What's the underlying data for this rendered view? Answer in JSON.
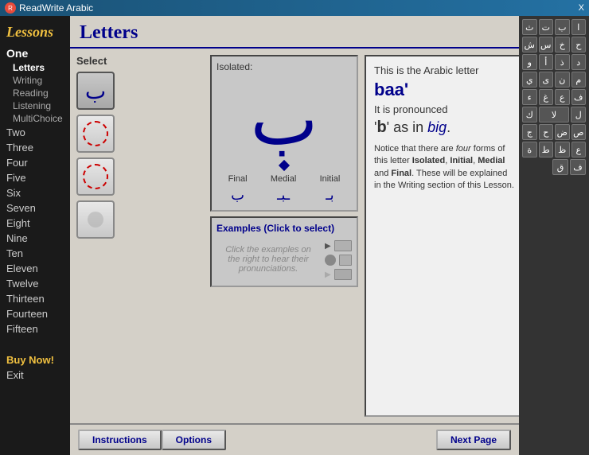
{
  "titlebar": {
    "title": "ReadWrite Arabic",
    "close_label": "X"
  },
  "sidebar": {
    "title": "Lessons",
    "items": [
      {
        "label": "One",
        "type": "main"
      },
      {
        "label": "Letters",
        "type": "sub",
        "active": true
      },
      {
        "label": "Writing",
        "type": "sub"
      },
      {
        "label": "Reading",
        "type": "sub"
      },
      {
        "label": "Listening",
        "type": "sub"
      },
      {
        "label": "MultiChoice",
        "type": "sub"
      },
      {
        "label": "Two",
        "type": "main"
      },
      {
        "label": "Three",
        "type": "main"
      },
      {
        "label": "Four",
        "type": "main"
      },
      {
        "label": "Five",
        "type": "main"
      },
      {
        "label": "Six",
        "type": "main"
      },
      {
        "label": "Seven",
        "type": "main"
      },
      {
        "label": "Eight",
        "type": "main"
      },
      {
        "label": "Nine",
        "type": "main"
      },
      {
        "label": "Ten",
        "type": "main"
      },
      {
        "label": "Eleven",
        "type": "main"
      },
      {
        "label": "Twelve",
        "type": "main"
      },
      {
        "label": "Thirteen",
        "type": "main"
      },
      {
        "label": "Fourteen",
        "type": "main"
      },
      {
        "label": "Fifteen",
        "type": "main"
      }
    ],
    "buy_label": "Buy Now!",
    "exit_label": "Exit"
  },
  "page": {
    "title": "Letters"
  },
  "select": {
    "label": "Select",
    "isolated_label": "Isolated:"
  },
  "letter": {
    "arabic_isolated": "ب",
    "arabic_final": "ب",
    "arabic_medial": "ـبـ",
    "arabic_initial": "بـ",
    "name": "baa'",
    "forms": [
      "Final",
      "Medial",
      "Initial"
    ],
    "intro": "This is the Arabic letter",
    "pronounced_label": "It is pronounced",
    "pronunciation_char": "'b'",
    "pronunciation_as": " as in ",
    "pronunciation_word": "big",
    "notice": "Notice that there are four forms of this letter Isolated, Initial, Medial and Final. These will be explained in the Writing section of this Lesson."
  },
  "examples": {
    "title": "Examples (Click to select)",
    "placeholder": "Click the examples on the right to hear their pronunciations."
  },
  "toolbar": {
    "instructions_label": "Instructions",
    "options_label": "Options",
    "next_label": "Next Page"
  },
  "arabic_keys": [
    [
      "ث",
      "ت",
      "ب",
      "ا"
    ],
    [
      "ش",
      "س",
      "خ",
      "ح"
    ],
    [
      "و",
      "أ",
      "ذ",
      "د"
    ],
    [
      "ي",
      "ى",
      "ن",
      "م"
    ],
    [
      "ء",
      "غ",
      "ع",
      "ظ"
    ],
    [
      "ك",
      "لا",
      "ل",
      "ق"
    ],
    [
      "ص",
      "ض",
      "ج",
      "ح"
    ],
    [
      "ة",
      "ط",
      "ظ",
      "ع"
    ],
    [
      "ف",
      "ق",
      ""
    ]
  ]
}
